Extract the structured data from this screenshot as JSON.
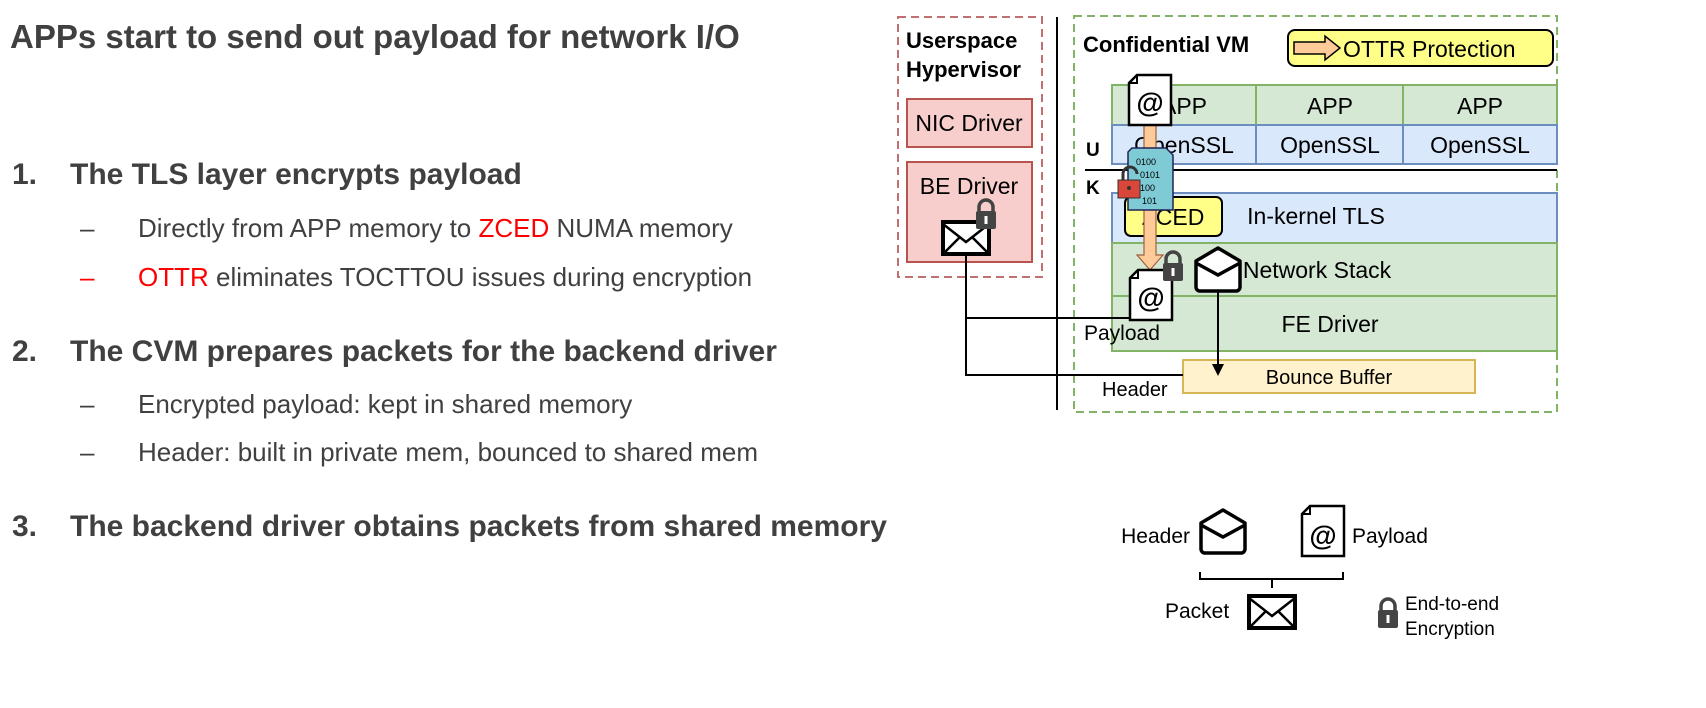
{
  "slide": {
    "title": "APPs start to send out payload for network I/O",
    "items": [
      {
        "number": "1.",
        "text": "The TLS layer encrypts payload",
        "subitems": [
          {
            "dash": "–",
            "before": "Directly from APP memory to ",
            "highlight": "ZCED",
            "after": " NUMA memory"
          },
          {
            "dash": "–",
            "before": "",
            "highlight": "OTTR",
            "after": " eliminates TOCTTOU issues during encryption"
          }
        ]
      },
      {
        "number": "2.",
        "text": "The CVM prepares packets for the backend driver",
        "subitems": [
          {
            "dash": "–",
            "text": "Encrypted payload: kept in shared memory"
          },
          {
            "dash": "–",
            "text": "Header: built in private mem, bounced to shared mem"
          }
        ]
      },
      {
        "number": "3.",
        "text": "The backend driver obtains packets from shared memory"
      }
    ]
  },
  "diagram": {
    "hypervisor": {
      "title_line1": "Userspace",
      "title_line2": "Hypervisor",
      "nic_driver": "NIC Driver",
      "be_driver": "BE Driver"
    },
    "cvm": {
      "title": "Confidential VM",
      "ottr_legend": "OTTR Protection",
      "apps": [
        "APP",
        "APP",
        "APP"
      ],
      "openssl": [
        "OpenSSL",
        "OpenSSL",
        "OpenSSL"
      ],
      "user_label": "U",
      "kernel_label": "K",
      "zced": "ZCED",
      "in_kernel_tls": "In-kernel TLS",
      "network_stack": "Network Stack",
      "fe_driver": "FE Driver",
      "payload_label": "Payload",
      "header_label": "Header",
      "bounce_buffer": "Bounce Buffer",
      "payload_glyph": "@"
    },
    "legend": {
      "header": "Header",
      "payload": "Payload",
      "packet": "Packet",
      "encryption_line1": "End-to-end",
      "encryption_line2": "Encryption"
    },
    "colors": {
      "highlight_red": "#ff0000",
      "red_box_fill": "#f8cecc",
      "red_box_border": "#b85450",
      "green_fill": "#d5e8d4",
      "green_border": "#82b366",
      "blue_fill": "#dae8fc",
      "blue_border": "#6c8ebf",
      "yellow_fill": "#ffff88",
      "bounce_fill": "#fff2cc",
      "ottr_arrow": "#ffcc99"
    }
  }
}
